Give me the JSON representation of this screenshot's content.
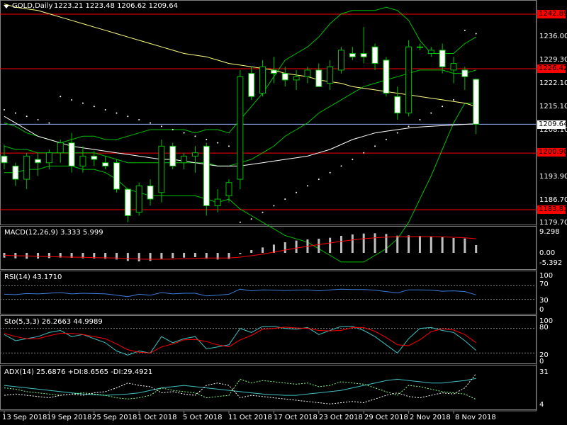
{
  "header": {
    "symbol": "GOLD,Daily",
    "ohlc": "1223.21 1223.48 1206.62 1209.64"
  },
  "colors": {
    "bg": "#000000",
    "grid": "#ffffff",
    "red": "#ff0000",
    "green": "#00c000",
    "ma_fast": "#ffff80",
    "ma_slow": "#ffffff",
    "psar": "#ffffff",
    "rsi": "#3b7ddd",
    "sig": "#ff0000"
  },
  "main_panel": {
    "price_axis": [
      "1236.00",
      "1229.30",
      "1222.10",
      "1215.10",
      "1208.10",
      "1193.90",
      "1186.70",
      "1179.70"
    ],
    "hlines": [
      {
        "label": "1242.89",
        "style": "red"
      },
      {
        "label": "1226.42",
        "style": "red"
      },
      {
        "label": "1209.64",
        "style": "white"
      },
      {
        "label": "1200.90",
        "style": "red"
      },
      {
        "label": "1183.81",
        "style": "red"
      }
    ]
  },
  "macd_panel": {
    "title": "MACD(12,26,9) 3.333 5.999",
    "axis": [
      "9.298",
      "0.00",
      "-5.392"
    ]
  },
  "rsi_panel": {
    "title": "RSI(14) 43.1710",
    "axis": [
      "100",
      "70",
      "30",
      "0"
    ]
  },
  "sto_panel": {
    "title": "Sto(5,3,3) 26.2663 44.9989",
    "axis": [
      "100",
      "80",
      "20",
      "0"
    ]
  },
  "adx_panel": {
    "title": "ADX(14) 25.6876 +DI:8.6565 -DI:29.4921",
    "axis": [
      "31",
      "4"
    ]
  },
  "x_axis": {
    "labels": [
      "13 Sep 2018",
      "19 Sep 2018",
      "25 Sep 2018",
      "1 Oct 2018",
      "5 Oct 2018",
      "11 Oct 2018",
      "17 Oct 2018",
      "23 Oct 2018",
      "29 Oct 2018",
      "2 Nov 2018",
      "8 Nov 2018"
    ]
  },
  "chart_data": {
    "type": "candlestick",
    "instrument": "GOLD",
    "timeframe": "Daily",
    "ohlc": [
      [
        1200,
        1203.5,
        1196,
        1198
      ],
      [
        1197,
        1198,
        1191,
        1193
      ],
      [
        1193,
        1201,
        1190,
        1200
      ],
      [
        1199,
        1201,
        1194,
        1198
      ],
      [
        1198,
        1202,
        1196,
        1201
      ],
      [
        1201,
        1205,
        1198,
        1204
      ],
      [
        1204,
        1207,
        1195,
        1197
      ],
      [
        1197,
        1203,
        1195,
        1200
      ],
      [
        1200,
        1201.5,
        1197,
        1199
      ],
      [
        1198,
        1200,
        1196,
        1197
      ],
      [
        1198,
        1199,
        1189,
        1190
      ],
      [
        1190,
        1188,
        1180,
        1182
      ],
      [
        1183,
        1192,
        1182,
        1191
      ],
      [
        1191,
        1193,
        1185,
        1187
      ],
      [
        1189,
        1205,
        1186,
        1203
      ],
      [
        1203,
        1204,
        1196,
        1197
      ],
      [
        1198,
        1201,
        1196,
        1200
      ],
      [
        1200,
        1203,
        1195,
        1201
      ],
      [
        1203,
        1204,
        1182,
        1185
      ],
      [
        1185,
        1190,
        1183,
        1187
      ],
      [
        1188,
        1193,
        1186,
        1192
      ],
      [
        1193,
        1226,
        1190,
        1224
      ],
      [
        1225,
        1227,
        1217,
        1218
      ],
      [
        1219,
        1229,
        1218,
        1227
      ],
      [
        1226,
        1230,
        1222,
        1225
      ],
      [
        1225,
        1227,
        1221,
        1223
      ],
      [
        1223,
        1226,
        1220,
        1224
      ],
      [
        1224,
        1227,
        1222,
        1226
      ],
      [
        1226,
        1228,
        1221,
        1221
      ],
      [
        1222,
        1229,
        1220,
        1227
      ],
      [
        1226,
        1233,
        1225,
        1232
      ],
      [
        1231,
        1233,
        1229,
        1230
      ],
      [
        1231,
        1239,
        1228,
        1230
      ],
      [
        1233,
        1234,
        1226,
        1228
      ],
      [
        1229,
        1230,
        1218,
        1219
      ],
      [
        1218,
        1221,
        1211,
        1213
      ],
      [
        1213,
        1235,
        1212,
        1233
      ],
      [
        1233,
        1234,
        1232,
        1233
      ],
      [
        1231,
        1233,
        1230,
        1232
      ],
      [
        1232,
        1234,
        1225,
        1227
      ],
      [
        1226,
        1230,
        1222,
        1228
      ],
      [
        1226,
        1227,
        1220,
        1224
      ],
      [
        1223.21,
        1223.48,
        1206.62,
        1209.64
      ]
    ],
    "bollinger_upper": [
      1210,
      1209,
      1207,
      1206,
      1205,
      1204,
      1205,
      1206,
      1206,
      1205,
      1205,
      1206,
      1207,
      1208,
      1208,
      1208,
      1208,
      1207,
      1208,
      1208,
      1207,
      1211,
      1215,
      1219,
      1224,
      1229,
      1231,
      1233,
      1236,
      1240,
      1243,
      1244,
      1244,
      1244,
      1245,
      1244,
      1241,
      1235,
      1231,
      1231,
      1231,
      1234,
      1236
    ],
    "bollinger_middle": [
      1203,
      1202,
      1202,
      1201,
      1201,
      1201,
      1201,
      1201,
      1201,
      1200,
      1199,
      1198,
      1198,
      1198,
      1198,
      1198,
      1198,
      1198,
      1198,
      1197,
      1197,
      1198,
      1199,
      1201,
      1203,
      1206,
      1208,
      1210,
      1213,
      1215,
      1217,
      1219,
      1221,
      1222,
      1223,
      1224,
      1225,
      1226,
      1226,
      1226,
      1225,
      1225,
      1226
    ],
    "bollinger_lower": [
      1195,
      1195,
      1196,
      1196,
      1197,
      1197,
      1197,
      1196,
      1196,
      1195,
      1193,
      1190,
      1189,
      1188,
      1188,
      1188,
      1188,
      1188,
      1187,
      1186,
      1187,
      1184,
      1182,
      1180,
      1178,
      1176,
      1175,
      1174,
      1172,
      1170,
      1168,
      1168,
      1168,
      1170,
      1172,
      1175,
      1180,
      1187,
      1194,
      1202,
      1210,
      1216,
      1216
    ],
    "ma_fast": [
      1246,
      1245,
      1244.5,
      1244,
      1243,
      1242,
      1241,
      1240,
      1239,
      1238,
      1237,
      1236,
      1235,
      1234,
      1233,
      1232,
      1231,
      1230.5,
      1230,
      1229,
      1228,
      1227.5,
      1227,
      1226.5,
      1226,
      1225,
      1224.5,
      1224,
      1223,
      1222.5,
      1222,
      1221,
      1220.5,
      1220,
      1219.5,
      1219,
      1218.5,
      1218,
      1217.5,
      1217,
      1216.5,
      1216,
      1215
    ],
    "ma_slow": [
      1212,
      1210,
      1208,
      1206,
      1205,
      1204,
      1203,
      1202.5,
      1202,
      1201.5,
      1201,
      1200.5,
      1200,
      1199.5,
      1199,
      1199,
      1198.5,
      1198,
      1197.5,
      1197,
      1197,
      1197,
      1197.5,
      1198,
      1198.5,
      1199,
      1199.5,
      1200,
      1201,
      1202,
      1203.5,
      1205,
      1206,
      1207,
      1207.5,
      1208,
      1208.5,
      1208.8,
      1209,
      1209.2,
      1209.4,
      1209.6,
      1209.8
    ],
    "psar": [
      1214,
      1213,
      1212,
      1211,
      1210,
      1218,
      1217,
      1216,
      1215,
      1214,
      1213,
      1212,
      1211,
      1210,
      1209,
      1208,
      1207,
      1206,
      1205,
      1204,
      1203,
      1180,
      1181,
      1183,
      1185,
      1187,
      1189,
      1191,
      1193,
      1195,
      1197,
      1199,
      1201,
      1203,
      1205,
      1207,
      1209,
      1211,
      1213,
      1215,
      1217,
      1238,
      1237
    ],
    "macd": [
      -2.0,
      -2.3,
      -2.5,
      -2.4,
      -2.2,
      -2.0,
      -2.1,
      -2.3,
      -2.4,
      -2.5,
      -2.8,
      -3.4,
      -3.6,
      -3.4,
      -2.5,
      -2.2,
      -2.0,
      -1.8,
      -2.5,
      -2.8,
      -2.6,
      -0.5,
      1.2,
      2.3,
      3.5,
      4.5,
      5.2,
      5.7,
      6.0,
      6.4,
      7.2,
      7.8,
      8.2,
      8.3,
      8.0,
      7.3,
      7.4,
      7.2,
      7.0,
      6.6,
      6.3,
      6.1,
      3.3
    ],
    "macd_signal": [
      -1.0,
      -1.2,
      -1.3,
      -1.5,
      -1.6,
      -1.7,
      -1.8,
      -1.9,
      -2.0,
      -2.1,
      -2.2,
      -2.4,
      -2.6,
      -2.7,
      -2.7,
      -2.6,
      -2.5,
      -2.3,
      -2.2,
      -2.2,
      -2.2,
      -1.8,
      -1.2,
      -0.5,
      0.3,
      1.2,
      2.0,
      2.8,
      3.5,
      4.2,
      4.9,
      5.5,
      6.0,
      6.4,
      6.7,
      6.8,
      6.9,
      6.9,
      6.9,
      6.8,
      6.6,
      6.4,
      6.0
    ],
    "rsi": [
      45,
      44,
      47,
      46,
      48,
      50,
      46,
      48,
      47,
      46,
      42,
      38,
      45,
      42,
      50,
      46,
      48,
      48,
      40,
      42,
      45,
      60,
      55,
      58,
      57,
      56,
      57,
      58,
      55,
      58,
      60,
      59,
      59,
      57,
      53,
      49,
      58,
      58,
      57,
      54,
      55,
      53,
      43.17
    ],
    "sto_k": [
      65,
      50,
      55,
      60,
      70,
      75,
      60,
      65,
      55,
      45,
      25,
      15,
      25,
      20,
      60,
      45,
      55,
      60,
      30,
      35,
      40,
      80,
      70,
      85,
      85,
      80,
      78,
      82,
      65,
      75,
      85,
      85,
      75,
      60,
      40,
      20,
      55,
      80,
      82,
      75,
      70,
      50,
      26.27
    ],
    "sto_d": [
      68,
      60,
      55,
      55,
      62,
      68,
      68,
      65,
      60,
      55,
      42,
      28,
      22,
      20,
      35,
      42,
      52,
      53,
      48,
      40,
      35,
      52,
      63,
      78,
      80,
      83,
      81,
      80,
      75,
      74,
      75,
      82,
      82,
      73,
      58,
      40,
      38,
      52,
      72,
      79,
      76,
      65,
      45.0
    ],
    "adx": [
      20,
      19,
      18,
      17,
      16,
      15,
      14,
      13,
      12.5,
      12,
      12.5,
      13,
      14,
      16,
      18,
      19,
      20,
      19,
      18,
      17,
      16,
      15,
      14,
      13,
      12.5,
      12,
      12,
      13,
      14,
      15,
      16,
      18,
      20,
      22,
      24,
      25,
      24,
      23,
      22,
      22,
      23,
      24,
      25.69
    ],
    "plus_di": [
      18,
      17,
      15,
      14,
      13,
      12,
      13,
      14,
      13,
      12,
      10,
      9,
      10,
      12,
      18,
      16,
      15,
      14,
      10,
      11,
      12,
      25,
      22,
      24,
      23,
      22,
      21,
      22,
      19,
      20,
      23,
      22,
      21,
      18,
      15,
      12,
      20,
      19,
      17,
      15,
      14,
      13,
      8.66
    ],
    "minus_di": [
      12,
      13,
      12,
      11,
      10,
      12,
      13,
      12,
      14,
      15,
      18,
      22,
      20,
      19,
      14,
      15,
      13,
      12,
      20,
      22,
      20,
      10,
      12,
      11,
      10,
      9,
      8,
      7,
      6,
      5,
      6,
      7,
      6,
      9,
      12,
      14,
      11,
      10,
      12,
      14,
      13,
      18,
      29.49
    ]
  }
}
